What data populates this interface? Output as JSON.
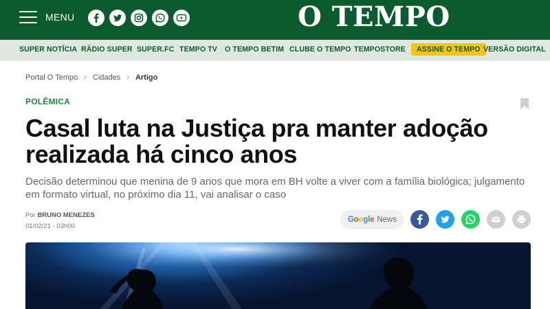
{
  "header": {
    "menu_label": "MENU",
    "brand": "O TEMPO",
    "social_icons": [
      "facebook-icon",
      "twitter-icon",
      "instagram-icon",
      "whatsapp-icon",
      "youtube-icon"
    ]
  },
  "nav": {
    "items": [
      "SUPER NOTÍCIA",
      "RÁDIO SUPER",
      "SUPER.FC",
      "TEMPO TV",
      "O TEMPO BETIM",
      "CLUBE O TEMPO",
      "TEMPOSTORE",
      "ASSINE O TEMPO",
      "VERSÃO DIGITAL"
    ]
  },
  "breadcrumb": [
    "Portal O Tempo",
    "Cidades",
    "Artigo"
  ],
  "article": {
    "tag": "POLÊMICA",
    "headline": "Casal luta na Justiça pra manter adoção realizada há cinco anos",
    "subtitle": "Decisão determinou que menina de 9 anos que mora em BH volte a viver com a família biológica; julgamento em formato virtual, no próximo dia 11, vai analisar o caso",
    "author_prefix": "Por",
    "author": "BRUNO MENEZES",
    "date": "01/02/21 - 03h00"
  },
  "share": {
    "google_word": "Google",
    "news_word": "News",
    "buttons": [
      "facebook-icon",
      "twitter-icon",
      "whatsapp-icon",
      "email-icon",
      "print-icon"
    ]
  },
  "colors": {
    "brand_green": "#0c5b2f",
    "nav_bg": "#dfe8e0",
    "tag_green": "#1f8a3b",
    "subscribe_yellow": "#f5c518",
    "facebook": "#3b5998",
    "twitter": "#1da1f2",
    "whatsapp": "#25d366",
    "neutral_button": "#d0d0d0"
  }
}
